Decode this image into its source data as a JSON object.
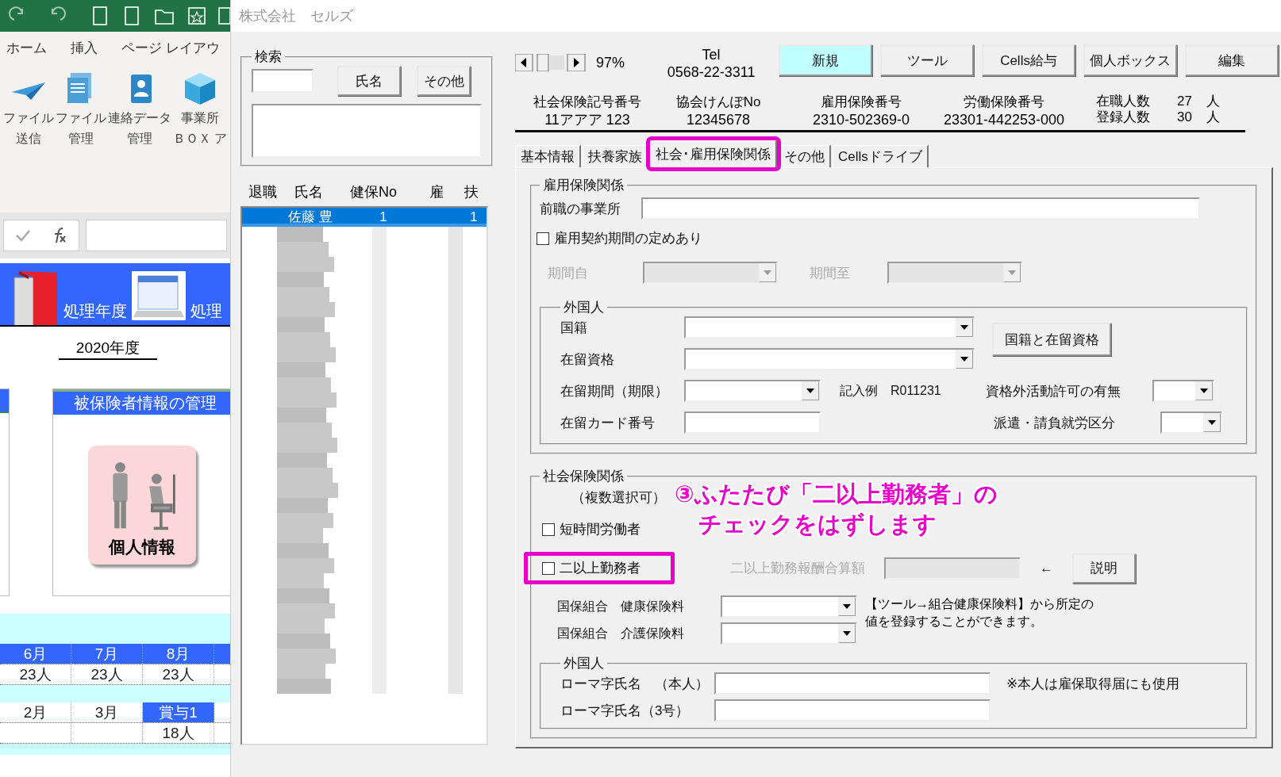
{
  "excel": {
    "ribbon_tabs": [
      "ホーム",
      "挿入",
      "ページ レイアウ"
    ],
    "ribbon_buttons": [
      {
        "kind": "plane",
        "lines": [
          "ファイル",
          "送信"
        ]
      },
      {
        "kind": "doc",
        "lines": [
          "ファイル",
          "管理"
        ]
      },
      {
        "kind": "contact",
        "lines": [
          "連絡データ",
          "管理"
        ]
      },
      {
        "kind": "cube",
        "lines": [
          "事業所",
          "ＢＯＸ ア"
        ]
      }
    ],
    "sheet": {
      "banner_labels": [
        "処理年度",
        "処理"
      ],
      "year": "2020年度",
      "panel_title": "被保険者情報の管理",
      "personal_button": "個人情報",
      "month_rows": [
        {
          "kind": "head",
          "cells": [
            {
              "text": "6月",
              "highlighted": true
            },
            {
              "text": "7月",
              "highlighted": true
            },
            {
              "text": "8月",
              "highlighted": true
            }
          ]
        },
        {
          "kind": "body",
          "cells": [
            {
              "text": "23人",
              "highlighted": false
            },
            {
              "text": "23人",
              "highlighted": false
            },
            {
              "text": "23人",
              "highlighted": false
            }
          ]
        },
        {
          "kind": "head",
          "cells": [
            {
              "text": "2月",
              "highlighted": false
            },
            {
              "text": "3月",
              "highlighted": false
            },
            {
              "text": "賞与1",
              "highlighted": true
            }
          ]
        },
        {
          "kind": "body",
          "cells": [
            {
              "text": "",
              "highlighted": false
            },
            {
              "text": "",
              "highlighted": false
            },
            {
              "text": "18人",
              "highlighted": false
            }
          ]
        }
      ]
    }
  },
  "dialog": {
    "title": "株式会社　セルズ",
    "search": {
      "label": "検索",
      "buttons": [
        "氏名",
        "その他"
      ]
    },
    "list": {
      "columns": [
        "退職",
        "氏名",
        "健保No",
        "雇",
        "扶"
      ],
      "rows": [
        {
          "cells": [
            "",
            "佐藤 豊",
            "1",
            "",
            "1"
          ],
          "selected": true
        }
      ]
    },
    "zoom_reading": "97%",
    "tel": {
      "label": "Tel",
      "number": "0568-22-3311"
    },
    "toolbar": [
      {
        "label": "新規",
        "highlighted": true
      },
      {
        "label": "ツール",
        "highlighted": false
      },
      {
        "label": "Cells給与",
        "highlighted": false
      },
      {
        "label": "個人ボックス",
        "highlighted": false
      },
      {
        "label": "編集",
        "highlighted": false
      }
    ],
    "info": [
      {
        "label": "社会保険記号番号",
        "value": "11アアア 123"
      },
      {
        "label": "協会けんぽNo",
        "value": "12345678"
      },
      {
        "label": "雇用保険番号",
        "value": "2310-502369-0"
      },
      {
        "label": "労働保険番号",
        "value": "23301-442253-000"
      }
    ],
    "counts": [
      {
        "label": "在職人数",
        "value": "27",
        "unit": "人"
      },
      {
        "label": "登録人数",
        "value": "30",
        "unit": "人"
      }
    ],
    "tabs": [
      {
        "label": "基本情報",
        "selected": false,
        "highlighted": false
      },
      {
        "label": "扶養家族",
        "selected": false,
        "highlighted": false
      },
      {
        "label": "社会･雇用保険関係",
        "selected": true,
        "highlighted": true
      },
      {
        "label": "その他",
        "selected": false,
        "highlighted": false
      },
      {
        "label": "Cellsドライブ",
        "selected": false,
        "highlighted": false
      }
    ],
    "employment": {
      "title": "雇用保険関係",
      "prev_office_label": "前職の事業所",
      "contract": {
        "label": "雇用契約期間の定めあり",
        "checked": false
      },
      "periods": [
        {
          "label": "期間自",
          "disabled": true
        },
        {
          "label": "期間至",
          "disabled": true
        }
      ],
      "foreign": {
        "title": "外国人",
        "nationality_label": "国籍",
        "status_label": "在留資格",
        "lookup_button": "国籍と在留資格",
        "period_label": "在留期間（期限）",
        "example": "記入例　R011231",
        "card_label": "在留カード番号",
        "permit_label": "資格外活動許可の有無",
        "dispatch_label": "派遣・請負就労区分"
      }
    },
    "social": {
      "title": "社会保険関係",
      "note": "（複数選択可）",
      "checkboxes": [
        {
          "label": "短時間労働者",
          "checked": false,
          "highlighted": false
        },
        {
          "label": "二以上勤務者",
          "checked": false,
          "highlighted": true
        }
      ],
      "combined": {
        "label": "二以上勤務報酬合算額",
        "disabled": true
      },
      "arrow": "←",
      "explain_button": "説明",
      "kokuho": [
        "国保組合　健康保険料",
        "国保組合　介護保険料"
      ],
      "kokuho_note": "【ツール→組合健康保険料】から所定の値を登録することができます。",
      "foreign": {
        "title": "外国人",
        "rows": [
          "ローマ字氏名　（本人）",
          "ローマ字氏名（3号）"
        ],
        "note": "※本人は雇保取得届にも使用"
      }
    },
    "annotation": [
      "③ふたたび「二以上勤務者」の",
      "チェックをはずします"
    ]
  }
}
